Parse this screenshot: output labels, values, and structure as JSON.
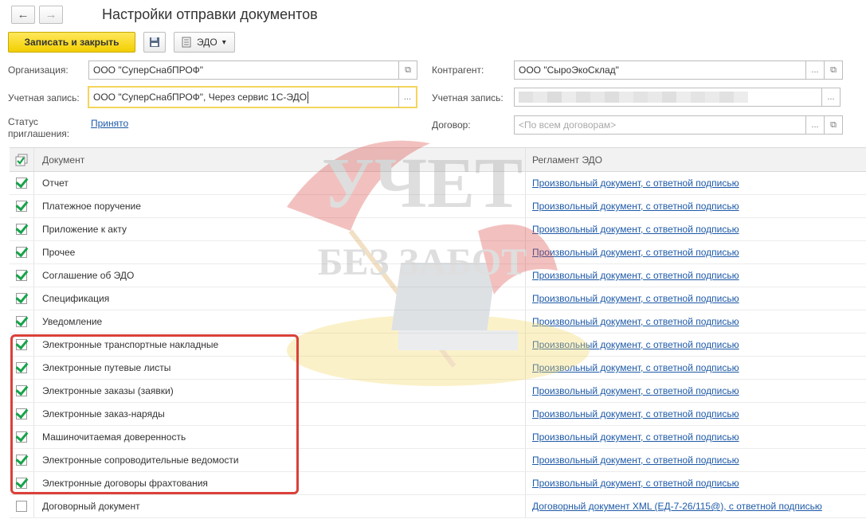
{
  "window": {
    "title": "Настройки отправки документов"
  },
  "nav": {
    "back": "←",
    "forward": "→"
  },
  "toolbar": {
    "save_close_label": "Записать и закрыть",
    "edo_label": "ЭДО",
    "edo_caret": "▾"
  },
  "form": {
    "organization_label": "Организация:",
    "organization_value": "ООО \"СуперСнабПРОФ\"",
    "account_label": "Учетная запись:",
    "account_value": "ООО \"СуперСнабПРОФ\", Через сервис 1С-ЭДО",
    "status_label": "Статус приглашения:",
    "status_value": "Принято",
    "counterparty_label": "Контрагент:",
    "counterparty_value": "ООО \"СыроЭкоСклад\"",
    "cp_account_label": "Учетная запись:",
    "contract_label": "Договор:",
    "contract_placeholder": "<По всем договорам>",
    "dots": "...",
    "open_glyph": "⧉"
  },
  "table": {
    "header_doc": "Документ",
    "header_reg": "Регламент ЭДО",
    "rows": [
      {
        "checked": true,
        "doc": "Отчет",
        "reg": "Произвольный документ, с ответной подписью"
      },
      {
        "checked": true,
        "doc": "Платежное поручение",
        "reg": "Произвольный документ, с ответной подписью"
      },
      {
        "checked": true,
        "doc": "Приложение к акту",
        "reg": "Произвольный документ, с ответной подписью"
      },
      {
        "checked": true,
        "doc": "Прочее",
        "reg": "Произвольный документ, с ответной подписью"
      },
      {
        "checked": true,
        "doc": "Соглашение об ЭДО",
        "reg": "Произвольный документ, с ответной подписью"
      },
      {
        "checked": true,
        "doc": "Спецификация",
        "reg": "Произвольный документ, с ответной подписью"
      },
      {
        "checked": true,
        "doc": "Уведомление",
        "reg": "Произвольный документ, с ответной подписью"
      },
      {
        "checked": true,
        "doc": "Электронные транспортные накладные",
        "reg": "Произвольный документ, с ответной подписью"
      },
      {
        "checked": true,
        "doc": "Электронные путевые листы",
        "reg": "Произвольный документ, с ответной подписью"
      },
      {
        "checked": true,
        "doc": "Электронные заказы (заявки)",
        "reg": "Произвольный документ, с ответной подписью"
      },
      {
        "checked": true,
        "doc": "Электронные заказ-наряды",
        "reg": "Произвольный документ, с ответной подписью"
      },
      {
        "checked": true,
        "doc": "Машиночитаемая доверенность",
        "reg": "Произвольный документ, с ответной подписью"
      },
      {
        "checked": true,
        "doc": "Электронные сопроводительные ведомости",
        "reg": "Произвольный документ, с ответной подписью"
      },
      {
        "checked": true,
        "doc": "Электронные договоры фрахтования",
        "reg": "Произвольный документ, с ответной подписью"
      },
      {
        "checked": false,
        "doc": "Договорный документ",
        "reg": "Договорный документ XML (ЕД-7-26/115@), с ответной подписью"
      }
    ]
  },
  "watermark": {
    "line1": "УЧЕТ",
    "line2": "БЕЗ ЗАБОТ"
  },
  "colors": {
    "accent": "#f2cf00",
    "link": "#1e5aa8",
    "check": "#16a34a",
    "highlight": "#d9413a"
  }
}
